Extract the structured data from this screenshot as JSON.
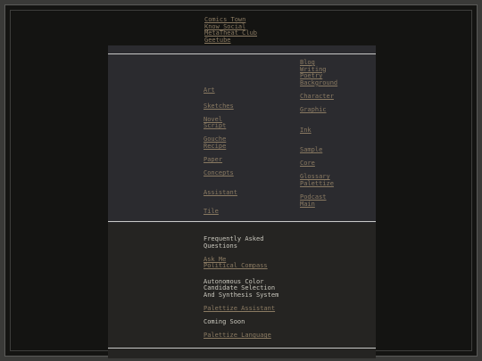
{
  "topnav": [
    "Comics Town",
    "Know Social",
    "MetaTheat Club",
    "Geetube"
  ],
  "left_links": {
    "art": "Art",
    "sketches": "Sketches",
    "novel": "Novel",
    "script": "Script",
    "gouche": "Gouche",
    "recipe": "Recipe",
    "paper": "Paper",
    "concepts": "Concepts",
    "assistant": "Assistant",
    "tile": "Tile"
  },
  "right_links": {
    "blog": "Blog",
    "writing": "Writing",
    "poetry": "Poetry",
    "background": "Background",
    "character": "Character",
    "graphic": "Graphic",
    "ink": "Ink",
    "sample": "Sample",
    "core": "Core",
    "glossary": "Glossary",
    "palettize": "Palettize",
    "podcast": "Podcast",
    "main": "Main"
  },
  "faq": {
    "heading_line1": "Frequently Asked",
    "heading_line2": "Questions",
    "ask_me": "Ask Me",
    "political_compass": "Political Compass",
    "system_line1": "Autonomous Color",
    "system_line2": "Candidate Selection",
    "system_line3": "And Synthesis System",
    "palettize_assistant": "Palettize Assistant",
    "coming_soon": "Coming Soon",
    "palettize_language": "Palettize Language"
  },
  "colors": {
    "background": "#141412",
    "panel_top": "#2b2b2f",
    "panel_bottom": "#252422",
    "link": "#8a7a62",
    "text": "#c9c7bd"
  }
}
